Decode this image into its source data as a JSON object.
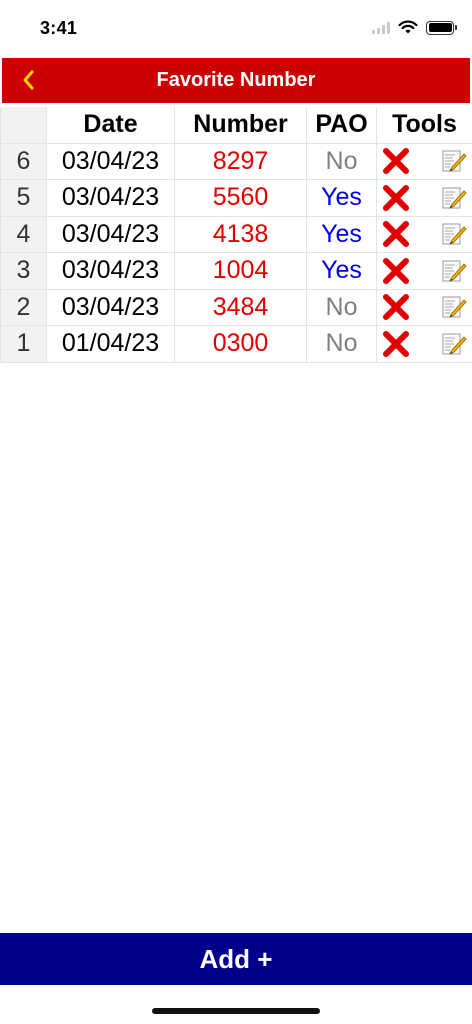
{
  "status_bar": {
    "time": "3:41",
    "icons": [
      "signal-icon",
      "wifi-icon",
      "battery-icon"
    ]
  },
  "nav_bar": {
    "title": "Favorite Number",
    "back_icon": "chevron-left-icon",
    "background_color": "#cc0000",
    "back_icon_color": "#ffd700"
  },
  "table": {
    "headers": {
      "index": "",
      "date": "Date",
      "number": "Number",
      "pao": "PAO",
      "tools": "Tools"
    },
    "rows": [
      {
        "index": "6",
        "date": "03/04/23",
        "number": "8297",
        "pao": "No"
      },
      {
        "index": "5",
        "date": "03/04/23",
        "number": "5560",
        "pao": "Yes"
      },
      {
        "index": "4",
        "date": "03/04/23",
        "number": "4138",
        "pao": "Yes"
      },
      {
        "index": "3",
        "date": "03/04/23",
        "number": "1004",
        "pao": "Yes"
      },
      {
        "index": "2",
        "date": "03/04/23",
        "number": "3484",
        "pao": "No"
      },
      {
        "index": "1",
        "date": "01/04/23",
        "number": "0300",
        "pao": "No"
      }
    ],
    "tool_icons": [
      "delete-x-icon",
      "edit-memo-icon"
    ],
    "colors": {
      "number": "#e00000",
      "pao_yes": "#0000e6",
      "pao_no": "#808080"
    }
  },
  "add_button": {
    "label": "Add +",
    "background_color": "#00008b"
  }
}
